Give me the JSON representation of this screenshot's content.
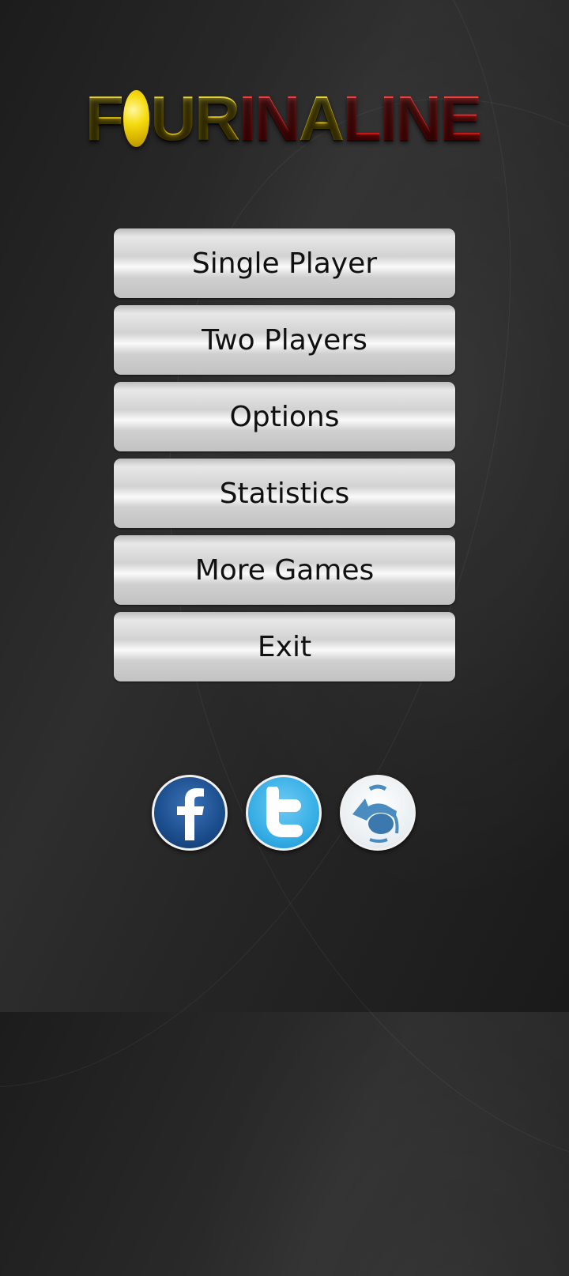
{
  "logo": {
    "parts": [
      "F",
      "O",
      "UR",
      "IN",
      "A",
      "LINE"
    ],
    "yellow": "#f4dc10",
    "red": "#f01818"
  },
  "menu": {
    "buttons": [
      {
        "label": "Single Player"
      },
      {
        "label": "Two Players"
      },
      {
        "label": "Options"
      },
      {
        "label": "Statistics"
      },
      {
        "label": "More Games"
      },
      {
        "label": "Exit"
      }
    ]
  },
  "social": {
    "icons": [
      "facebook-icon",
      "twitter-icon",
      "app-brand-icon"
    ],
    "colors": {
      "facebook": "#1b4d8c",
      "twitter": "#36aee6",
      "brand": "#4a8cc0"
    }
  }
}
